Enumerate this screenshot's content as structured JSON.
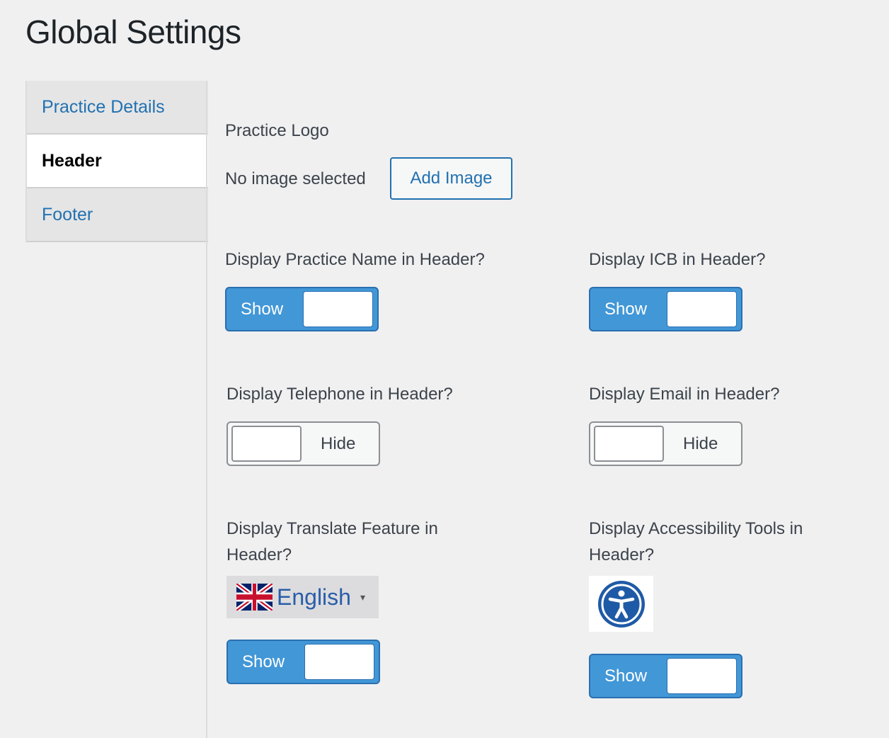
{
  "page": {
    "title": "Global Settings"
  },
  "tabs": [
    {
      "label": "Practice Details",
      "active": false
    },
    {
      "label": "Header",
      "active": true
    },
    {
      "label": "Footer",
      "active": false
    }
  ],
  "logo": {
    "heading": "Practice Logo",
    "status": "No image selected",
    "button_label": "Add Image"
  },
  "settings": {
    "practice_name": {
      "label": "Display Practice Name in Header?",
      "state": "Show"
    },
    "icb": {
      "label": "Display ICB in Header?",
      "state": "Show"
    },
    "telephone": {
      "label": "Display Telephone in Header?",
      "state": "Hide"
    },
    "email": {
      "label": "Display Email in Header?",
      "state": "Hide"
    },
    "translate": {
      "label_line1": "Display Translate Feature in",
      "label_line2": "Header?",
      "state": "Show"
    },
    "accessibility": {
      "label_line1": "Display Accessibility Tools in",
      "label_line2": "Header?",
      "state": "Show"
    }
  },
  "language_selector": {
    "value": "English",
    "caret": "▾",
    "flag_icon": "uk-flag-icon"
  },
  "accessibility_icon": {
    "icon": "accessibility-icon",
    "color": "#1f5aa6"
  },
  "colors": {
    "accent": "#2271b1",
    "toggle_on": "#4297d7",
    "background": "#f0f0f1"
  }
}
